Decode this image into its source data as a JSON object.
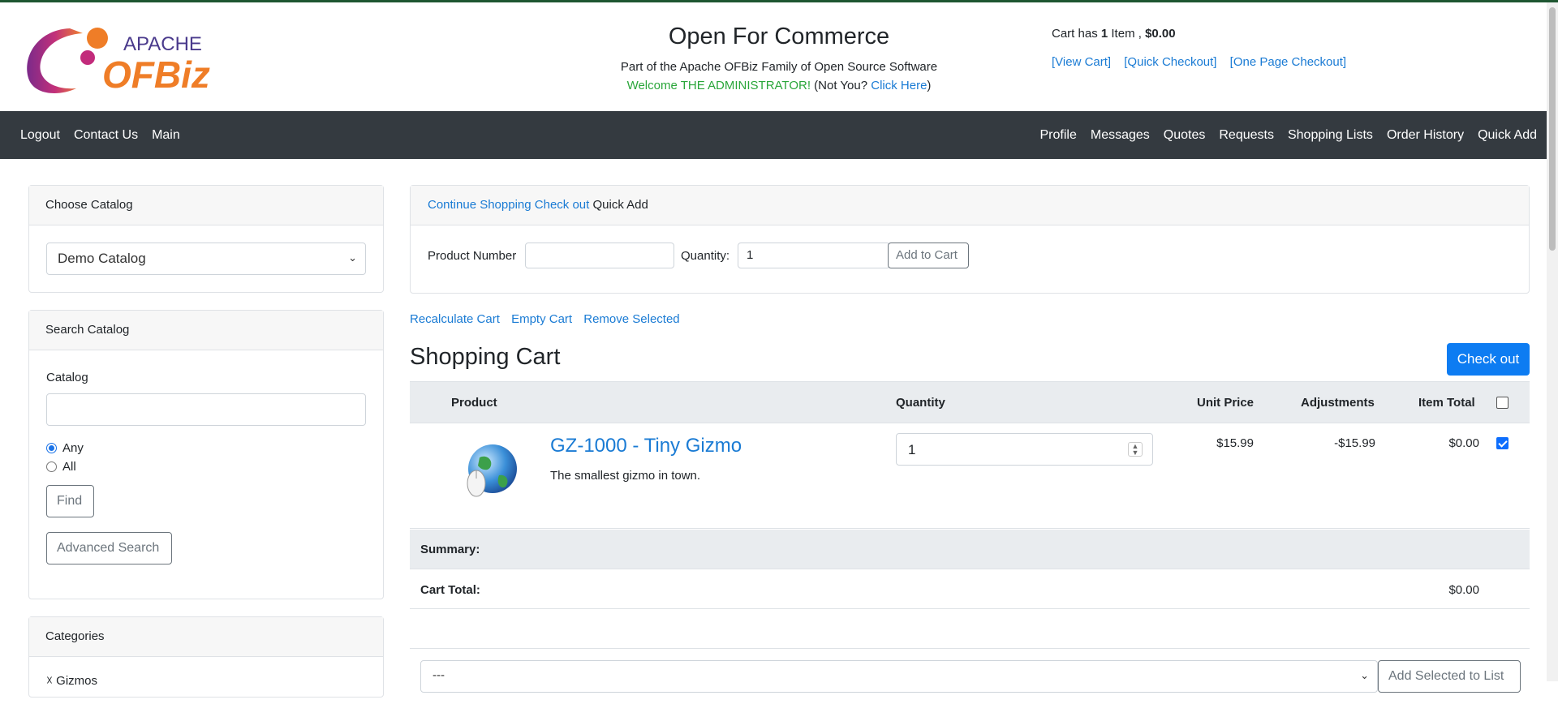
{
  "header": {
    "logo_text_top": "APACHE",
    "logo_text_main": "OFBiz",
    "store_title": "Open For Commerce",
    "subtitle": "Part of the Apache OFBiz Family of Open Source Software",
    "welcome_text": "Welcome THE ADMINISTRATOR!",
    "not_you": "(Not You?",
    "click_here": "Click Here",
    "close_paren": ")",
    "cart_summary_prefix": "Cart has",
    "cart_count": "1",
    "cart_summary_mid": "Item ,",
    "cart_total": "$0.00",
    "view_cart": "[View Cart]",
    "quick_checkout": "[Quick Checkout]",
    "one_page_checkout": "[One Page Checkout]"
  },
  "nav": {
    "left": [
      "Logout",
      "Contact Us",
      "Main"
    ],
    "right": [
      "Profile",
      "Messages",
      "Quotes",
      "Requests",
      "Shopping Lists",
      "Order History",
      "Quick Add"
    ]
  },
  "sidebar": {
    "choose_catalog": {
      "title": "Choose Catalog",
      "selected": "Demo Catalog"
    },
    "search_catalog": {
      "title": "Search Catalog",
      "catalog_label": "Catalog",
      "search_value": "",
      "radio_any": "Any",
      "radio_all": "All",
      "selected_radio": "Any",
      "find_label": "Find",
      "advanced_label": "Advanced Search"
    },
    "categories": {
      "title": "Categories",
      "first_item": "Gizmos"
    }
  },
  "quick_add": {
    "continue_shopping": "Continue Shopping",
    "check_out": "Check out",
    "quick_add": "Quick Add",
    "product_number_label": "Product Number",
    "product_number_value": "",
    "quantity_label": "Quantity:",
    "quantity_value": "1",
    "add_to_cart": "Add to Cart"
  },
  "cart_actions": [
    "Recalculate Cart",
    "Empty Cart",
    "Remove Selected"
  ],
  "cart": {
    "title": "Shopping Cart",
    "checkout_button": "Check out",
    "columns": {
      "product": "Product",
      "quantity": "Quantity",
      "unit_price": "Unit Price",
      "adjustments": "Adjustments",
      "item_total": "Item Total"
    },
    "items": [
      {
        "name": "GZ-1000 - Tiny Gizmo",
        "description": "The smallest gizmo in town.",
        "quantity": "1",
        "unit_price": "$15.99",
        "adjustments": "-$15.99",
        "item_total": "$0.00",
        "selected": true
      }
    ],
    "summary_label": "Summary:",
    "cart_total_label": "Cart Total:",
    "cart_total_value": "$0.00"
  },
  "list_controls": {
    "selected_list": "---",
    "add_selected": "Add Selected to List"
  },
  "colors": {
    "navbar": "#343a40",
    "link": "#1a7bd4",
    "primary": "#0d7cf2",
    "welcome_green": "#2aa63a"
  }
}
